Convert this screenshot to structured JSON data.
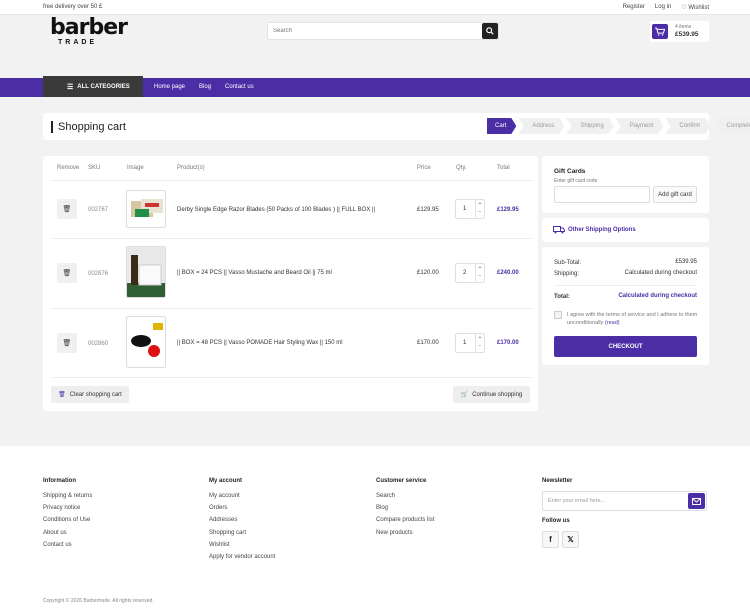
{
  "topbar": {
    "free_delivery": "free delivery over 50 £",
    "register": "Register",
    "login": "Log in",
    "wishlist": "Wishlist"
  },
  "brand": {
    "line1": "barber",
    "line2": "TRADE"
  },
  "search": {
    "placeholder": "Search"
  },
  "mini_cart": {
    "items": "4 items",
    "amount": "£539.95"
  },
  "nav": {
    "all_categories": "ALL CATEGORIES",
    "links": [
      "Home page",
      "Blog",
      "Contact us"
    ]
  },
  "page": {
    "title": "Shopping cart"
  },
  "steps": [
    "Cart",
    "Address",
    "Shipping",
    "Payment",
    "Confirm",
    "Complete"
  ],
  "table": {
    "headers": {
      "remove": "Remove",
      "sku": "SKU",
      "image": "Image",
      "product": "Product(s)",
      "price": "Price",
      "qty": "Qty.",
      "total": "Total"
    },
    "rows": [
      {
        "sku": "002767",
        "name": "Derby Single Edge Razor Blades (50 Packs of 100 Blades ) || FULL BOX ||",
        "price": "£129.95",
        "qty": "1",
        "total": "£129.95"
      },
      {
        "sku": "002876",
        "name": "|| BOX = 24 PCS || Vasso Mustache and Beard Oil || 75 ml",
        "price": "£120.00",
        "qty": "2",
        "total": "£240.00"
      },
      {
        "sku": "002860",
        "name": "|| BOX = 48 PCS || Vasso POMADE Hair Styling Wax || 150 ml",
        "price": "£170.00",
        "qty": "1",
        "total": "£170.00"
      }
    ],
    "clear": "Clear shopping cart",
    "continue": "Continue shopping"
  },
  "gift": {
    "title": "Gift Cards",
    "hint": "Enter gift card code",
    "button": "Add gift card"
  },
  "shipping_options": "Other Shipping Options",
  "summary": {
    "subtotal_label": "Sub-Total:",
    "subtotal": "£539.95",
    "shipping_label": "Shipping:",
    "shipping": "Calculated during checkout",
    "total_label": "Total:",
    "total": "Calculated during checkout",
    "terms": "I agree with the terms of service and I adhere to them unconditionally",
    "read": "(read)",
    "checkout": "CHECKOUT"
  },
  "footer": {
    "info": {
      "title": "Information",
      "links": [
        "Shipping & returns",
        "Privacy notice",
        "Conditions of Use",
        "About us",
        "Contact us"
      ]
    },
    "account": {
      "title": "My account",
      "links": [
        "My account",
        "Orders",
        "Addresses",
        "Shopping cart",
        "Wishlist",
        "Apply for vendor account"
      ]
    },
    "service": {
      "title": "Customer service",
      "links": [
        "Search",
        "Blog",
        "Compare products list",
        "New products"
      ]
    },
    "newsletter": {
      "title": "Newsletter",
      "placeholder": "Enter your email here...",
      "follow": "Follow us"
    },
    "copyright": "Copyright © 2026 Barbertrade. All rights reserved."
  },
  "colors": {
    "accent": "#4b2ea6",
    "dark": "#3a3a3a"
  }
}
